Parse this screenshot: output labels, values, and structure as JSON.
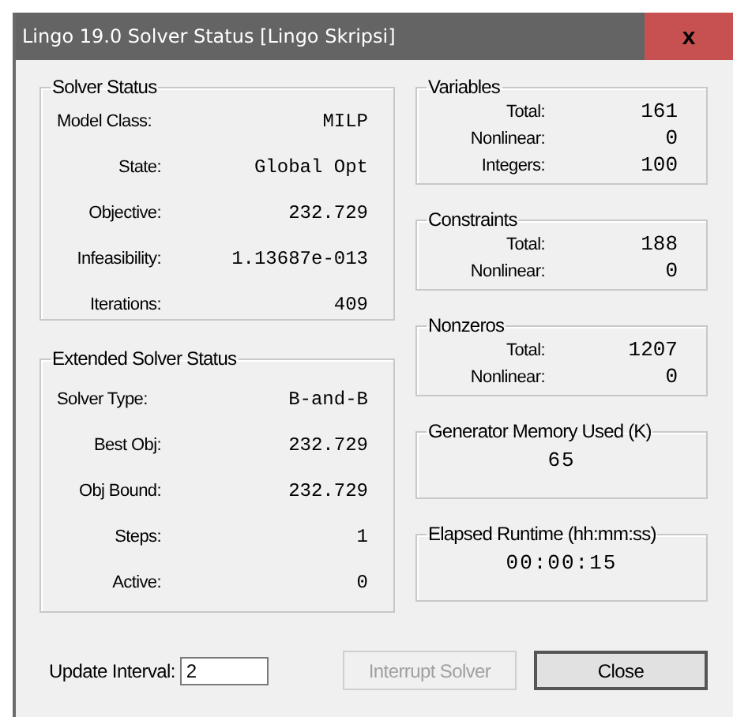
{
  "window": {
    "title": "Lingo 19.0 Solver Status [Lingo Skripsi]",
    "close_glyph": "x"
  },
  "left_groups": [
    {
      "title": "Solver Status",
      "rows": [
        {
          "label": "Model Class:",
          "value": "MILP"
        },
        {
          "label": "State:",
          "value": "Global Opt"
        },
        {
          "label": "Objective:",
          "value": "232.729"
        },
        {
          "label": "Infeasibility:",
          "value": "1.13687e-013"
        },
        {
          "label": "Iterations:",
          "value": "409"
        }
      ]
    },
    {
      "title": "Extended Solver Status",
      "rows": [
        {
          "label": "Solver Type:",
          "value": "B-and-B"
        },
        {
          "label": "Best Obj:",
          "value": "232.729"
        },
        {
          "label": "Obj Bound:",
          "value": "232.729"
        },
        {
          "label": "Steps:",
          "value": "1"
        },
        {
          "label": "Active:",
          "value": "0"
        }
      ]
    }
  ],
  "right_groups": [
    {
      "kind": "table",
      "title": "Variables",
      "rows": [
        {
          "label": "Total:",
          "value": "161"
        },
        {
          "label": "Nonlinear:",
          "value": "0"
        },
        {
          "label": "Integers:",
          "value": "100"
        }
      ]
    },
    {
      "kind": "table",
      "title": "Constraints",
      "rows": [
        {
          "label": "Total:",
          "value": "188"
        },
        {
          "label": "Nonlinear:",
          "value": "0"
        }
      ]
    },
    {
      "kind": "table",
      "title": "Nonzeros",
      "rows": [
        {
          "label": "Total:",
          "value": "1207"
        },
        {
          "label": "Nonlinear:",
          "value": "0"
        }
      ]
    },
    {
      "kind": "single",
      "title": "Generator Memory Used (K)",
      "value": "65"
    },
    {
      "kind": "single",
      "title": "Elapsed Runtime (hh:mm:ss)",
      "value": "00:00:15"
    }
  ],
  "update_interval": {
    "label": "Update Interval:",
    "value": "2"
  },
  "buttons": [
    {
      "label": "Interrupt Solver",
      "disabled": true
    },
    {
      "label": "Close",
      "disabled": false
    }
  ]
}
